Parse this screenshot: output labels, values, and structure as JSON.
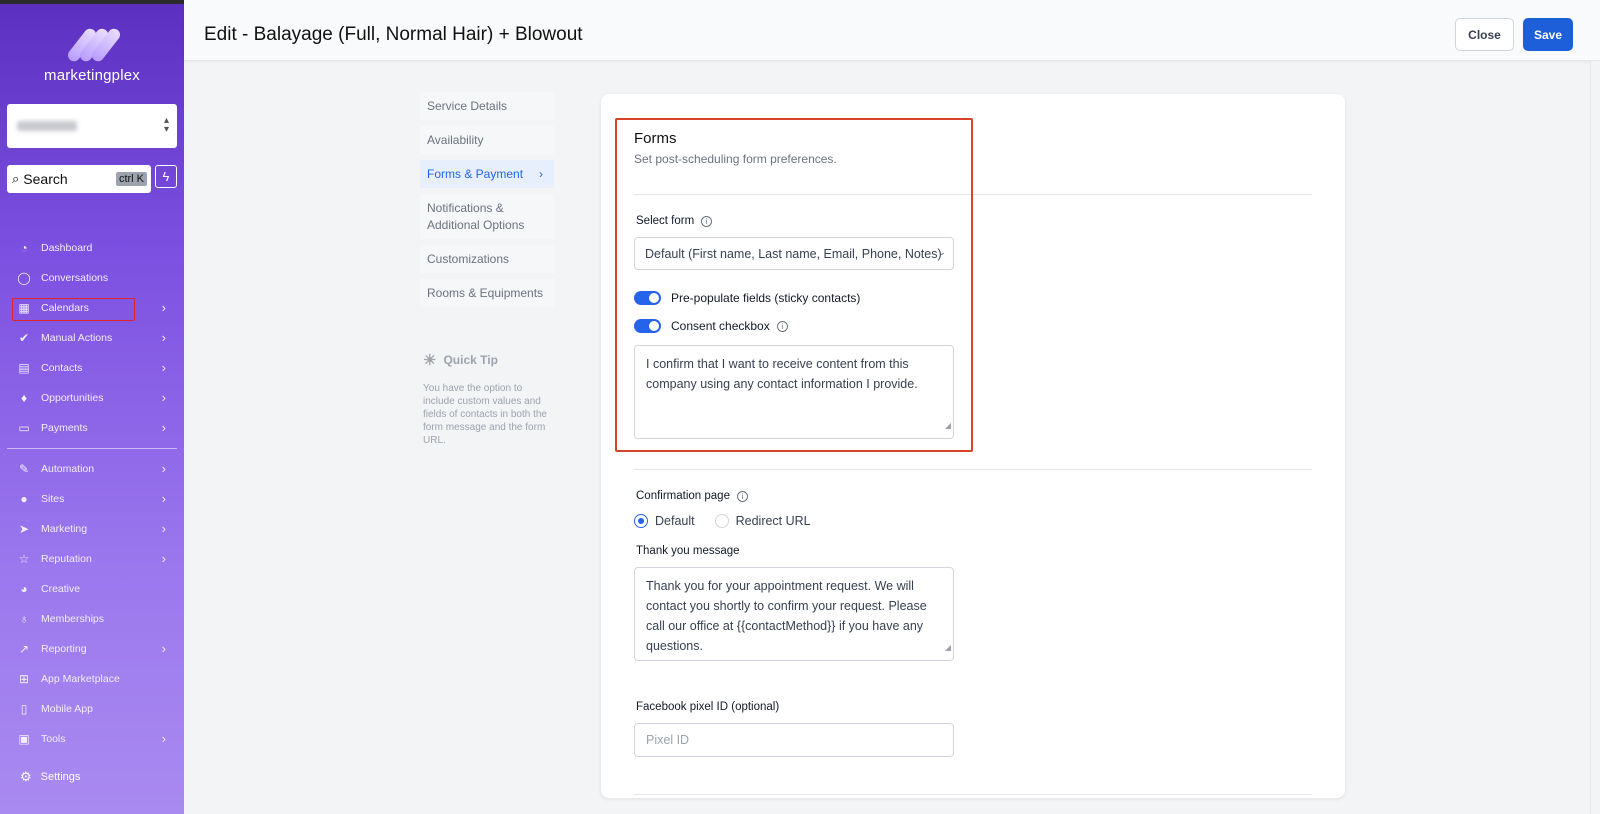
{
  "brand": {
    "name": "marketingplex"
  },
  "search": {
    "label": "Search",
    "shortcut": "ctrl K"
  },
  "nav": {
    "items": [
      {
        "label": "Dashboard",
        "icon": "dashboard-icon",
        "glyph": "◔"
      },
      {
        "label": "Conversations",
        "icon": "chat-icon",
        "glyph": "◯"
      },
      {
        "label": "Calendars",
        "icon": "calendar-icon",
        "glyph": "▦",
        "chev": "›"
      },
      {
        "label": "Manual Actions",
        "icon": "check-badge-icon",
        "glyph": "✔",
        "chev": "›"
      },
      {
        "label": "Contacts",
        "icon": "contacts-icon",
        "glyph": "▤",
        "chev": "›"
      },
      {
        "label": "Opportunities",
        "icon": "flame-icon",
        "glyph": "♦",
        "chev": "›"
      },
      {
        "label": "Payments",
        "icon": "card-icon",
        "glyph": "▭",
        "chev": "›"
      }
    ],
    "items2": [
      {
        "label": "Automation",
        "icon": "wand-icon",
        "glyph": "✎",
        "chev": "›"
      },
      {
        "label": "Sites",
        "icon": "globe-icon",
        "glyph": "●",
        "chev": "›"
      },
      {
        "label": "Marketing",
        "icon": "send-icon",
        "glyph": "➤",
        "chev": "›"
      },
      {
        "label": "Reputation",
        "icon": "star-icon",
        "glyph": "☆",
        "chev": "›"
      },
      {
        "label": "Creative",
        "icon": "palette-icon",
        "glyph": "◕"
      },
      {
        "label": "Memberships",
        "icon": "award-icon",
        "glyph": "♁"
      },
      {
        "label": "Reporting",
        "icon": "chart-icon",
        "glyph": "↗",
        "chev": "›"
      },
      {
        "label": "App Marketplace",
        "icon": "grid-icon",
        "glyph": "⊞"
      },
      {
        "label": "Mobile App",
        "icon": "phone-icon",
        "glyph": "▯"
      },
      {
        "label": "Tools",
        "icon": "toolbox-icon",
        "glyph": "▣",
        "chev": "›"
      }
    ],
    "settings": "Settings"
  },
  "header": {
    "title": "Edit - Balayage (Full, Normal Hair) + Blowout",
    "close_label": "Close",
    "save_label": "Save"
  },
  "subnav": {
    "service_details": "Service Details",
    "availability": "Availability",
    "forms_payment": "Forms & Payment",
    "notifications_1": "Notifications &",
    "notifications_2": "Additional Options",
    "customizations": "Customizations",
    "rooms": "Rooms & Equipments"
  },
  "tip": {
    "title": "Quick Tip",
    "body": "You have the option to include custom values and fields of contacts in both the form message and the form URL."
  },
  "forms": {
    "title": "Forms",
    "subtitle": "Set post-scheduling form preferences.",
    "select_label": "Select form",
    "select_value": "Default (First name, Last name, Email, Phone, Notes)",
    "prepopulate_label": "Pre-populate fields (sticky contacts)",
    "prepopulate_on": true,
    "consent_label": "Consent checkbox",
    "consent_on": true,
    "consent_text": "I confirm that I want to receive content from this company using any contact information I provide.",
    "confirmation_label": "Confirmation page",
    "radio_default": "Default",
    "radio_redirect": "Redirect URL",
    "confirmation_selected": "Default",
    "thankyou_label": "Thank you message",
    "thankyou_text": "Thank you for your appointment request. We will contact you shortly to confirm your request. Please call our office at {{contactMethod}} if you have any questions.",
    "pixel_label": "Facebook pixel ID (optional)",
    "pixel_placeholder": "Pixel ID"
  },
  "colors": {
    "accent": "#2563eb",
    "save": "#1d5fd8",
    "highlight": "#d9432a"
  }
}
